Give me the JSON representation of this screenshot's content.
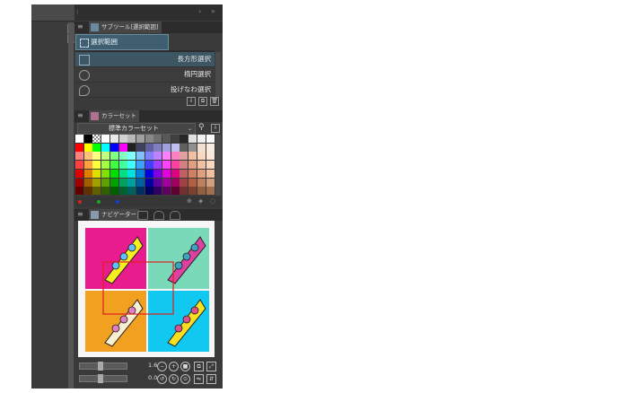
{
  "subtool_panel": {
    "tab_label": "サブツール[選択範囲]",
    "group_label": "選択範囲",
    "tools": [
      {
        "label": "長方形選択",
        "icon": "rect-select-icon"
      },
      {
        "label": "楕円選択",
        "icon": "ellipse-select-icon"
      },
      {
        "label": "投げなわ選択",
        "icon": "lasso-select-icon"
      }
    ]
  },
  "color_set_panel": {
    "tab_label": "カラーセット",
    "set_name": "標準カラーセット",
    "extra_dots": [
      "#e0201a",
      "#1aa82a",
      "#1a3ae0"
    ]
  },
  "navigator_panel": {
    "tab_label": "ナビゲーター",
    "zoom_value": "1.6",
    "rotate_value": "0.0",
    "quadrant_colors": [
      "#e81c8c",
      "#7ad9b8",
      "#f2a020",
      "#10c8f0"
    ]
  }
}
